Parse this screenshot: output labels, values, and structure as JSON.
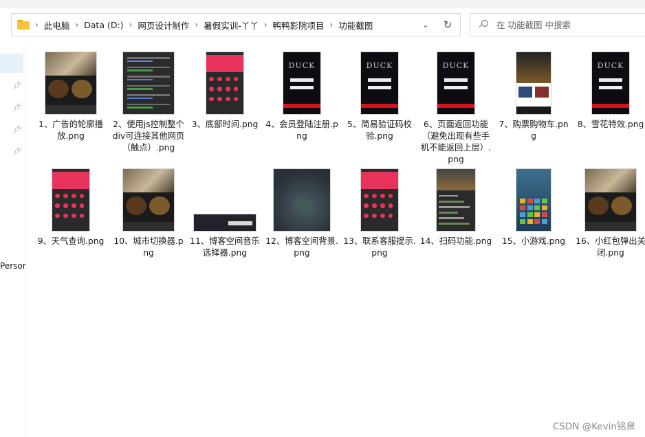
{
  "breadcrumb": {
    "items": [
      "此电脑",
      "Data (D:)",
      "网页设计制作",
      "暑假实训-丫丫",
      "鸭鸭影院项目",
      "功能截图"
    ]
  },
  "search": {
    "placeholder": "在 功能截图 中搜索"
  },
  "sidebar": {
    "person_label": "Persor"
  },
  "files": [
    {
      "label": "1、广告的轮廓播放.png",
      "thumb": "poster"
    },
    {
      "label": "2、使用js控制整个div可连接其他网页（触点）.png",
      "thumb": "list"
    },
    {
      "label": "3、底部时间.png",
      "thumb": "pinkgrid"
    },
    {
      "label": "4、会员登陆注册.png",
      "thumb": "duck"
    },
    {
      "label": "5、简易验证码校验.png",
      "thumb": "duck"
    },
    {
      "label": "6、页面返回功能（避免出现有些手机不能返回上层）.png",
      "thumb": "duck"
    },
    {
      "label": "7、购票购物车.png",
      "thumb": "shop"
    },
    {
      "label": "8、雪花特效.png",
      "thumb": "duck"
    },
    {
      "label": "9、天气查询.png",
      "thumb": "pinkgrid"
    },
    {
      "label": "10、城市切换器.png",
      "thumb": "poster"
    },
    {
      "label": "11、博客空间音乐选择器.png",
      "thumb": "musicbar"
    },
    {
      "label": "12、博客空间背景.png",
      "thumb": "space"
    },
    {
      "label": "13、联系客服提示.png",
      "thumb": "pinkgrid"
    },
    {
      "label": "14、扫码功能.png",
      "thumb": "code"
    },
    {
      "label": "15、小游戏.png",
      "thumb": "game"
    },
    {
      "label": "16、小红包弹出关闭.png",
      "thumb": "poster"
    }
  ],
  "thumb_text": {
    "duck_logo": "DUCK"
  },
  "watermark": "CSDN @Kevin铭泉",
  "colors": {
    "accent_pink": "#e8335c",
    "folder_yellow": "#f8c23a",
    "selection_blue": "#e5f1fb",
    "red_bar": "#d4141c"
  }
}
